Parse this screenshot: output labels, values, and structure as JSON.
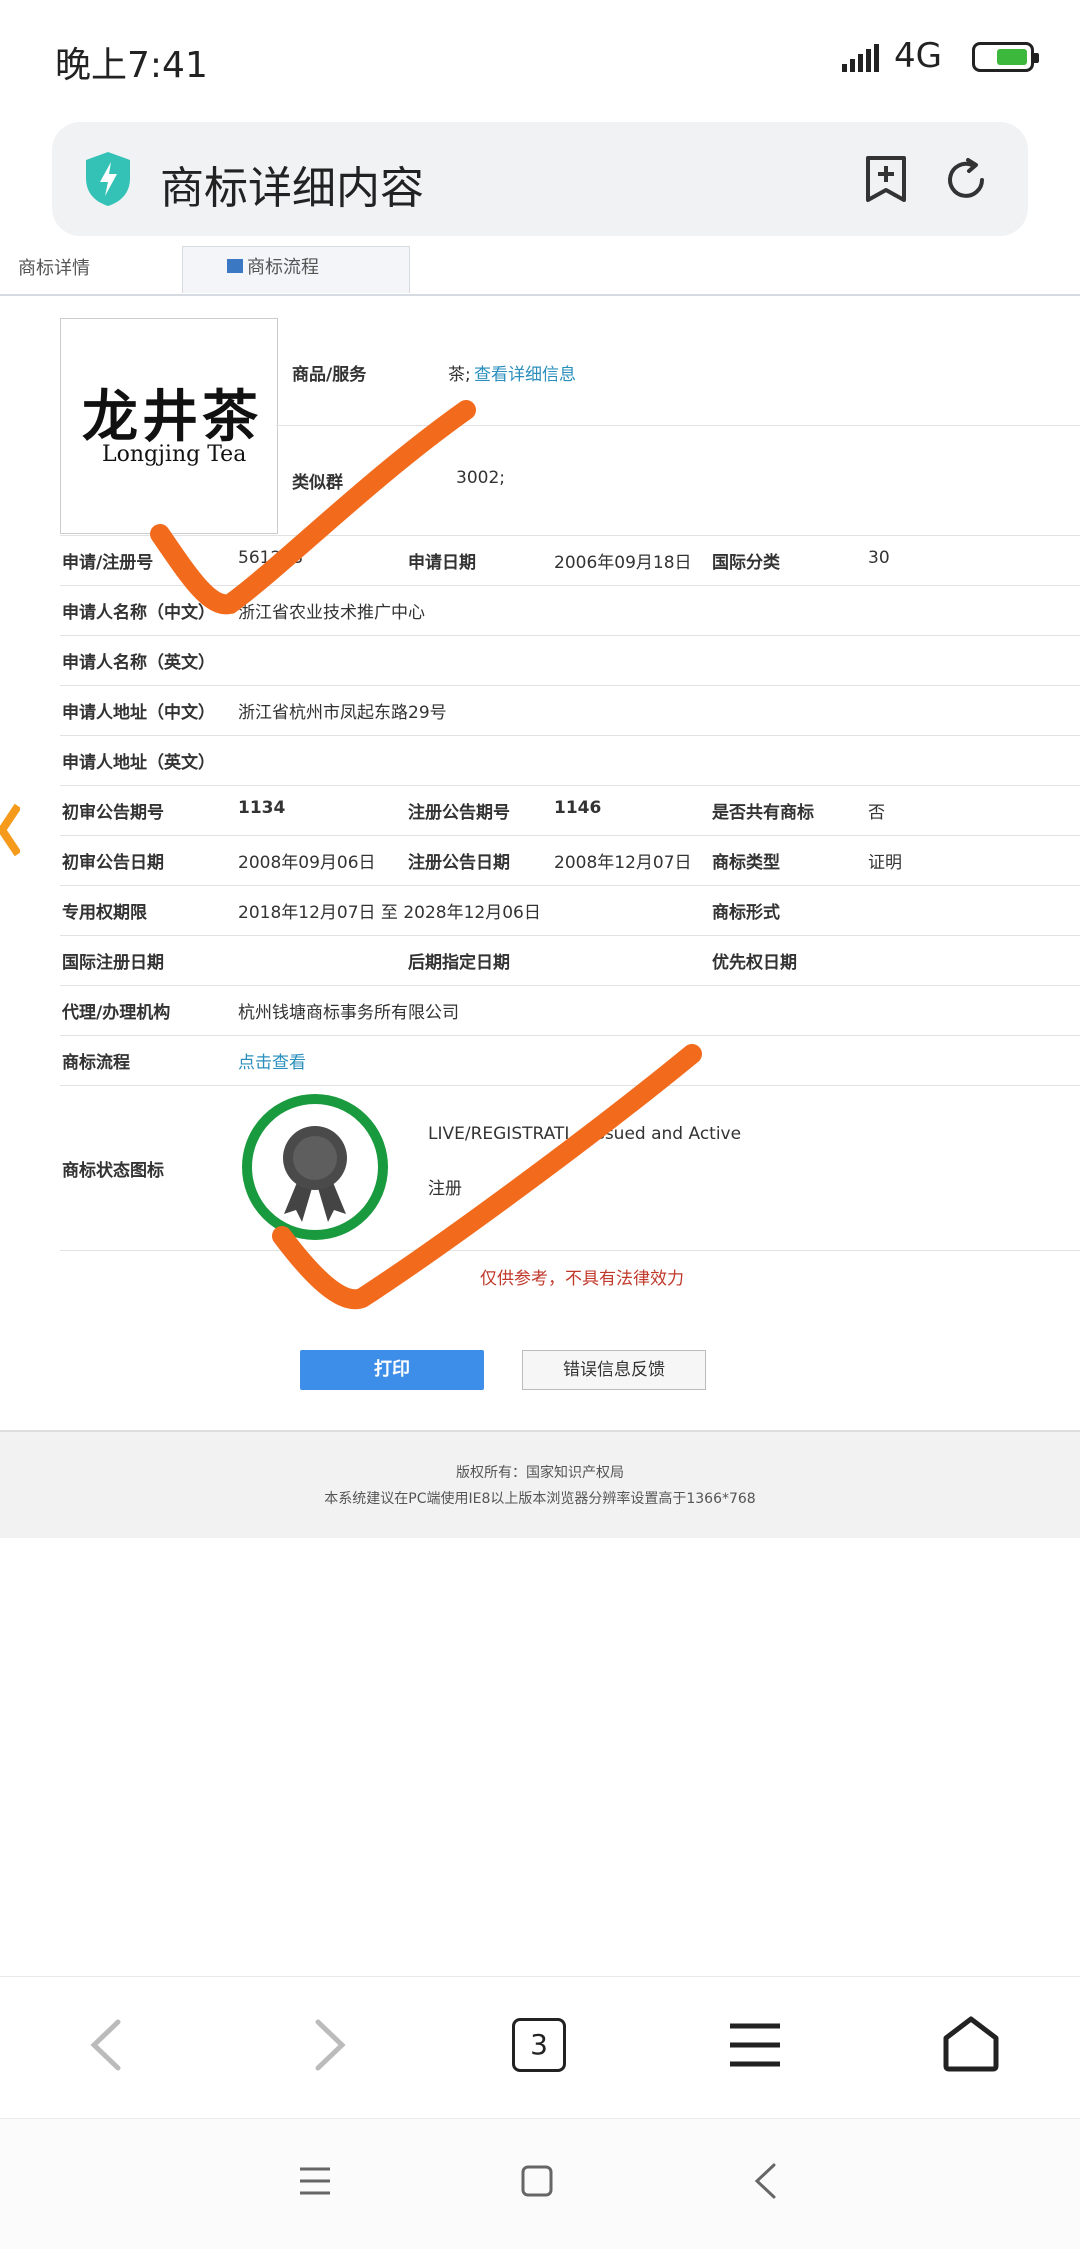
{
  "status_bar": {
    "time": "晚上7:41",
    "network": "4G"
  },
  "address_bar": {
    "title": "商标详细内容"
  },
  "tabs": {
    "detail": "商标详情",
    "flow": "商标流程"
  },
  "trademark_logo": {
    "cn": "龙井茶",
    "en": "Longjing Tea"
  },
  "goods": {
    "label": "商品/服务",
    "value": "茶;",
    "link": "查看详细信息"
  },
  "similar_group": {
    "label": "类似群",
    "value": "3002;"
  },
  "rows": {
    "reg_no_label": "申请/注册号",
    "reg_no": "561228",
    "apply_date_label": "申请日期",
    "apply_date": "2006年09月18日",
    "intl_class_label": "国际分类",
    "intl_class": "30",
    "applicant_cn_label": "申请人名称（中文）",
    "applicant_cn": "浙江省农业技术推广中心",
    "applicant_en_label": "申请人名称（英文）",
    "address_cn_label": "申请人地址（中文）",
    "address_cn": "浙江省杭州市凤起东路29号",
    "address_en_label": "申请人地址（英文）",
    "prelim_no_label": "初审公告期号",
    "prelim_no": "1134",
    "reg_pub_no_label": "注册公告期号",
    "reg_pub_no": "1146",
    "shared_label": "是否共有商标",
    "shared": "否",
    "prelim_date_label": "初审公告日期",
    "prelim_date": "2008年09月06日",
    "reg_pub_date_label": "注册公告日期",
    "reg_pub_date": "2008年12月07日",
    "tm_type_label": "商标类型",
    "tm_type": "证明",
    "term_label": "专用权期限",
    "term": "2018年12月07日 至 2028年12月06日",
    "tm_form_label": "商标形式",
    "intl_reg_date_label": "国际注册日期",
    "later_date_label": "后期指定日期",
    "priority_date_label": "优先权日期",
    "agent_label": "代理/办理机构",
    "agent": "杭州钱塘商标事务所有限公司",
    "flow_label": "商标流程",
    "flow_link": "点击查看",
    "status_icon_label": "商标状态图标",
    "status_en": "LIVE/REGISTRATI... Issued and Active",
    "status_cn": "注册"
  },
  "disclaimer": "仅供参考，不具有法律效力",
  "buttons": {
    "print": "打印",
    "feedback": "错误信息反馈"
  },
  "footer": {
    "copyright": "版权所有：国家知识产权局",
    "note": "本系统建议在PC端使用IE8以上版本浏览器分辨率设置高于1366*768"
  },
  "nav": {
    "tab_count": "3"
  },
  "colors": {
    "accent_blue": "#3d8ee8",
    "link": "#2a8fbd",
    "annotation": "#f26b1d",
    "badge_green": "#1a9a3e"
  }
}
